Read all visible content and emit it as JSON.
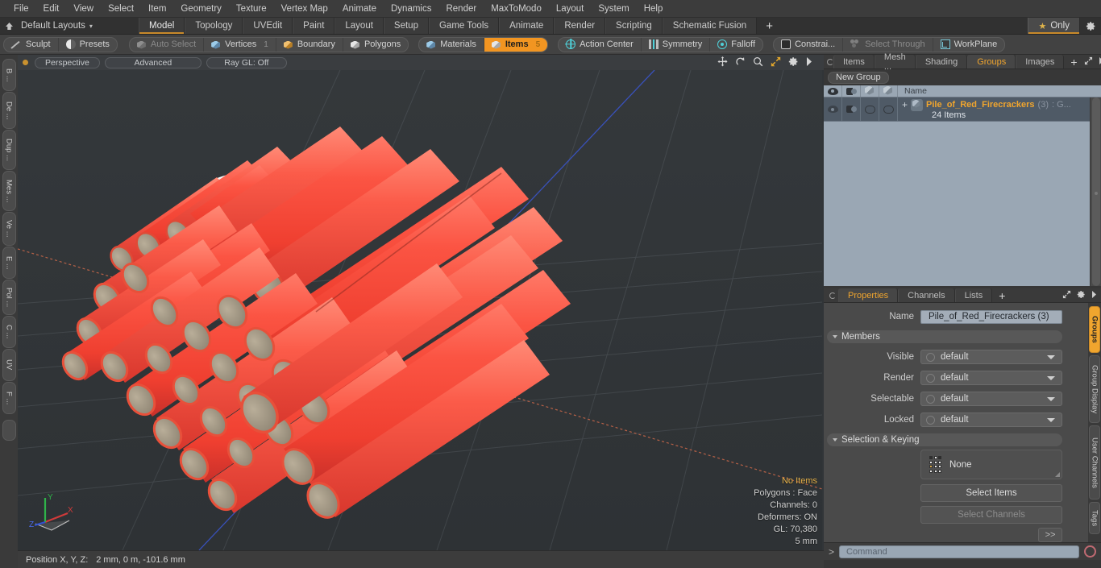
{
  "app": {
    "menu": [
      "File",
      "Edit",
      "View",
      "Select",
      "Item",
      "Geometry",
      "Texture",
      "Vertex Map",
      "Animate",
      "Dynamics",
      "Render",
      "MaxToModo",
      "Layout",
      "System",
      "Help"
    ]
  },
  "layoutbar": {
    "home_icon": "home-icon",
    "layout_preset": "Default Layouts",
    "caret": "▾",
    "tabs": [
      {
        "label": "Model",
        "active": true
      },
      {
        "label": "Topology",
        "active": false
      },
      {
        "label": "UVEdit",
        "active": false
      },
      {
        "label": "Paint",
        "active": false
      },
      {
        "label": "Layout",
        "active": false
      },
      {
        "label": "Setup",
        "active": false
      },
      {
        "label": "Game Tools",
        "active": false
      },
      {
        "label": "Animate",
        "active": false
      },
      {
        "label": "Render",
        "active": false
      },
      {
        "label": "Scripting",
        "active": false
      },
      {
        "label": "Schematic Fusion",
        "active": false
      }
    ],
    "add_tab": "+",
    "only_label": "Only",
    "only_star": "★",
    "gear": "⚙"
  },
  "modebar": {
    "left_group": [
      {
        "label": "Sculpt",
        "icon": "sculpt-icon",
        "state": "normal"
      },
      {
        "label": "Presets",
        "icon": "presets-icon",
        "state": "normal"
      }
    ],
    "select_group": [
      {
        "label": "Auto Select",
        "icon": "cube-gray-icon",
        "state": "dim",
        "num": ""
      },
      {
        "label": "Vertices",
        "icon": "cube-blue-icon",
        "state": "normal",
        "num": "1"
      },
      {
        "label": "Boundary",
        "icon": "cube-orange-icon",
        "state": "normal",
        "num": ""
      },
      {
        "label": "Polygons",
        "icon": "cube-white-icon",
        "state": "normal",
        "num": ""
      }
    ],
    "mode_group": [
      {
        "label": "Materials",
        "icon": "cube-blue-icon",
        "state": "normal",
        "num": ""
      },
      {
        "label": "Items",
        "icon": "cube-white-icon",
        "state": "active",
        "num": "5"
      }
    ],
    "right_group": [
      {
        "label": "Action Center",
        "icon": "action-center-icon",
        "state": "normal"
      },
      {
        "label": "Symmetry",
        "icon": "symmetry-icon",
        "state": "normal"
      },
      {
        "label": "Falloff",
        "icon": "falloff-icon",
        "state": "normal"
      }
    ],
    "constraint_group": [
      {
        "label": "Constrai...",
        "icon": "constraint-icon",
        "state": "normal"
      },
      {
        "label": "Select Through",
        "icon": "select-through-icon",
        "state": "dim"
      },
      {
        "label": "WorkPlane",
        "icon": "workplane-icon",
        "state": "normal"
      }
    ]
  },
  "left_toolbar": {
    "items": [
      "B ...",
      "De ...",
      "Dup ...",
      "Mes ...",
      "Ve ...",
      "E ...",
      "Pol ...",
      "C ...",
      "UV",
      "F ..."
    ]
  },
  "viewport": {
    "header": {
      "view_mode": "Perspective",
      "shading": "Advanced",
      "raygl": "Ray GL: Off",
      "icons": [
        "move-icon",
        "rotate-icon",
        "zoom-icon",
        "fit-icon",
        "gear-icon",
        "chevron-right-icon"
      ]
    },
    "status": {
      "selection": "No Items",
      "polygons": "Polygons : Face",
      "channels": "Channels: 0",
      "deformers": "Deformers: ON",
      "gl": "GL: 70,380",
      "scale": "5 mm"
    },
    "axis_gizmo": {
      "x": "X",
      "y": "Y",
      "z": "Z"
    }
  },
  "statusbar": {
    "position_label": "Position X, Y, Z:",
    "position_value": "2 mm, 0 m, -101.6 mm"
  },
  "right_panel": {
    "tabs": [
      {
        "label": "Items",
        "active": false
      },
      {
        "label": "Mesh ...",
        "active": false
      },
      {
        "label": "Shading",
        "active": false
      },
      {
        "label": "Groups",
        "active": true
      },
      {
        "label": "Images",
        "active": false
      }
    ],
    "add_tab": "+",
    "tab_icons": [
      "expand-icon",
      "chevron-right-icon"
    ],
    "new_group_button": "New Group",
    "list": {
      "columns": [
        "visible-col",
        "render-col",
        "select-col",
        "lock-col",
        "Name"
      ],
      "rows": [
        {
          "expander": "+",
          "name": "Pile_of_Red_Firecrackers",
          "count": "(3)",
          "suffix": ": G...",
          "sub": "24 Items"
        }
      ]
    }
  },
  "properties": {
    "tabs": [
      {
        "label": "Properties",
        "active": true
      },
      {
        "label": "Channels",
        "active": false
      },
      {
        "label": "Lists",
        "active": false
      }
    ],
    "add_tab": "+",
    "tab_icons": [
      "expand-icon",
      "gear-icon",
      "chevron-right-icon"
    ],
    "name_label": "Name",
    "name_value": "Pile_of_Red_Firecrackers (3)",
    "members_section": "Members",
    "fields": [
      {
        "label": "Visible",
        "value": "default"
      },
      {
        "label": "Render",
        "value": "default"
      },
      {
        "label": "Selectable",
        "value": "default"
      },
      {
        "label": "Locked",
        "value": "default"
      }
    ],
    "selection_section": "Selection & Keying",
    "none_value": "None",
    "select_items_button": "Select Items",
    "select_channels_button": "Select Channels",
    "expand_button": ">>"
  },
  "right_vtabs": [
    {
      "label": "Groups",
      "active": true
    },
    {
      "label": "Group Display",
      "active": false
    },
    {
      "label": "User Channels",
      "active": false
    },
    {
      "label": "Tags",
      "active": false
    }
  ],
  "command": {
    "prompt": ">",
    "placeholder": "Command",
    "record_icon": "record-icon"
  },
  "colors": {
    "accent_orange": "#f0a52e",
    "tab_underline": "#c98a2a",
    "firecracker_red": "#fa4a3c",
    "fuse_white": "#e8e8e8",
    "cap_tan": "#a69a84"
  }
}
